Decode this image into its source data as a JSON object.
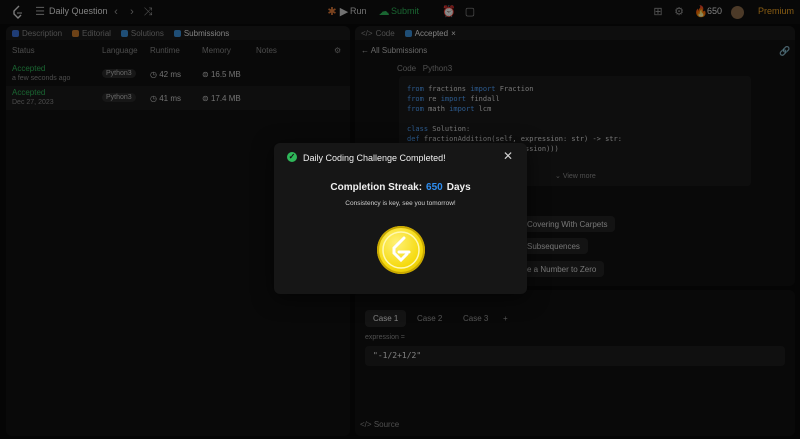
{
  "topbar": {
    "title": "Daily Question",
    "run_label": "Run",
    "submit_label": "Submit",
    "streak_count": "650",
    "premium_label": "Premium"
  },
  "left_panel": {
    "tabs": [
      {
        "label": "Description"
      },
      {
        "label": "Editorial"
      },
      {
        "label": "Solutions"
      },
      {
        "label": "Submissions"
      }
    ],
    "columns": [
      "Status",
      "Language",
      "Runtime",
      "Memory",
      "Notes"
    ],
    "rows": [
      {
        "status": "Accepted",
        "date": "a few seconds ago",
        "language": "Python3",
        "runtime": "42 ms",
        "memory": "16.5 MB"
      },
      {
        "status": "Accepted",
        "date": "Dec 27, 2023",
        "language": "Python3",
        "runtime": "41 ms",
        "memory": "17.4 MB"
      }
    ]
  },
  "right_panel": {
    "tabs": [
      {
        "label": "Code"
      },
      {
        "label": "Accepted"
      }
    ],
    "all_submissions": "All Submissions",
    "code_header": "Code",
    "code_lang": "Python3",
    "code_lines": [
      "from fractions import Fraction",
      "from re import findall",
      "from math import lcm",
      "",
      "class Solution:",
      "    def fractionAddition(self, expression: str) -> str:",
      "        ...findall(r\"\\/(\\w+)=\",expression)))"
    ],
    "view_more": "View more",
    "chips": [
      "Covering With Carpets",
      "Subsequences",
      "e a Number to Zero"
    ]
  },
  "bottom_panel": {
    "cases": [
      "Case 1",
      "Case 2",
      "Case 3"
    ],
    "expression_label": "expression =",
    "expression_value": "\"-1/2+1/2\"",
    "source_label": "Source"
  },
  "modal": {
    "title": "Daily Coding Challenge Completed!",
    "streak_label": "Completion Streak:",
    "streak_value": "650",
    "streak_unit": "Days",
    "subtitle": "Consistency is key, see you tomorrow!"
  },
  "colors": {
    "accent_green": "#2fb85a",
    "accent_blue": "#2f8ef0",
    "premium_orange": "#f5a623",
    "coin_yellow": "#f5d90a"
  }
}
